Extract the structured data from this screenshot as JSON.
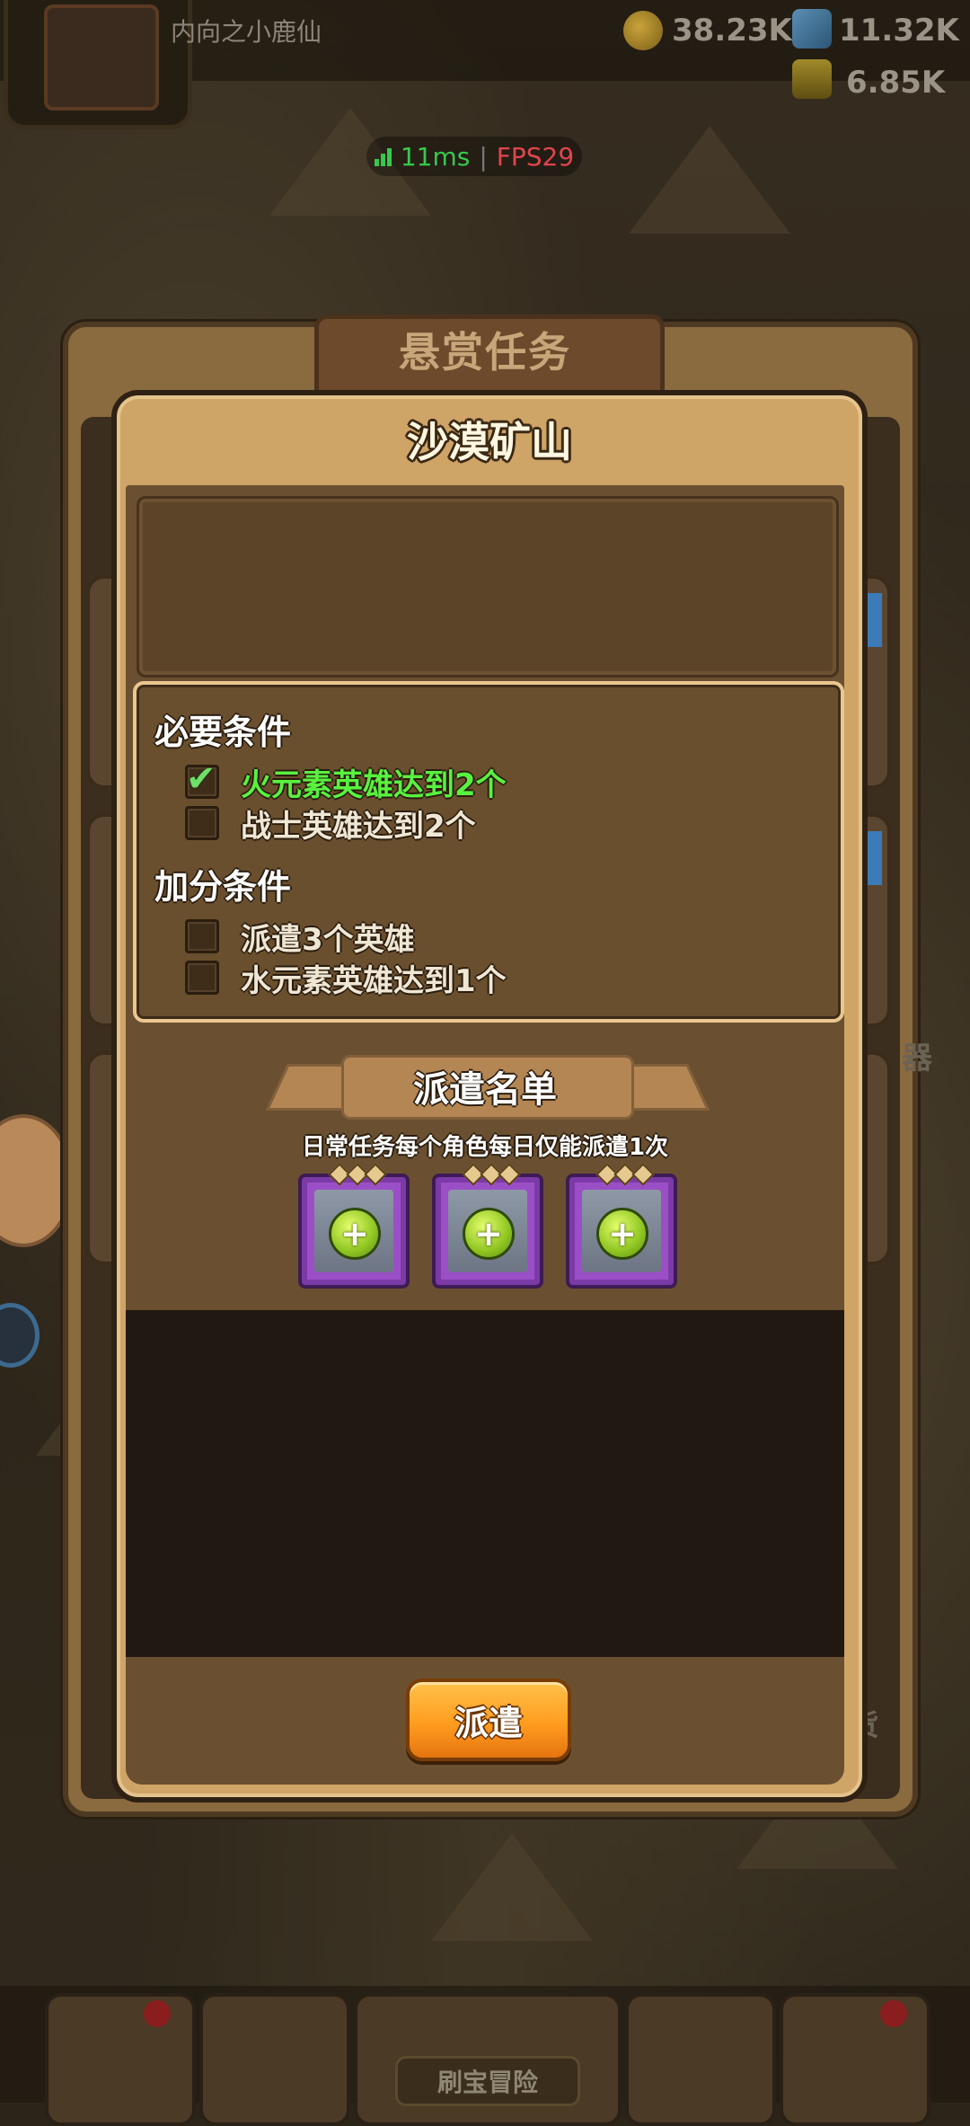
{
  "topbar": {
    "player_name": "内向之小鹿仙",
    "gold": "38.23K",
    "gems": "11.32K",
    "stamina": "6.85K"
  },
  "network": {
    "latency": "11ms",
    "separator": "|",
    "fps": "FPS29"
  },
  "bounty_panel": {
    "title": "悬赏任务",
    "side_label_right": "器",
    "side_label_bottom": "赀"
  },
  "mission": {
    "title": "沙漠矿山",
    "required_heading": "必要条件",
    "required": [
      {
        "text": "火元素英雄达到2个",
        "met": true
      },
      {
        "text": "战士英雄达到2个",
        "met": false
      }
    ],
    "bonus_heading": "加分条件",
    "bonus": [
      {
        "text": "派遣3个英雄",
        "met": false
      },
      {
        "text": "水元素英雄达到1个",
        "met": false
      }
    ],
    "roster_title": "派遣名单",
    "roster_note": "日常任务每个角色每日仅能派遣1次",
    "slots": [
      "+",
      "+",
      "+"
    ],
    "dispatch_label": "派遣"
  },
  "bottom_nav": {
    "center_label": "刷宝冒险"
  },
  "colors": {
    "met_condition": "#58f23f",
    "dispatch_button": "#ff9d1f",
    "slot_frame": "#9b4fc7"
  }
}
